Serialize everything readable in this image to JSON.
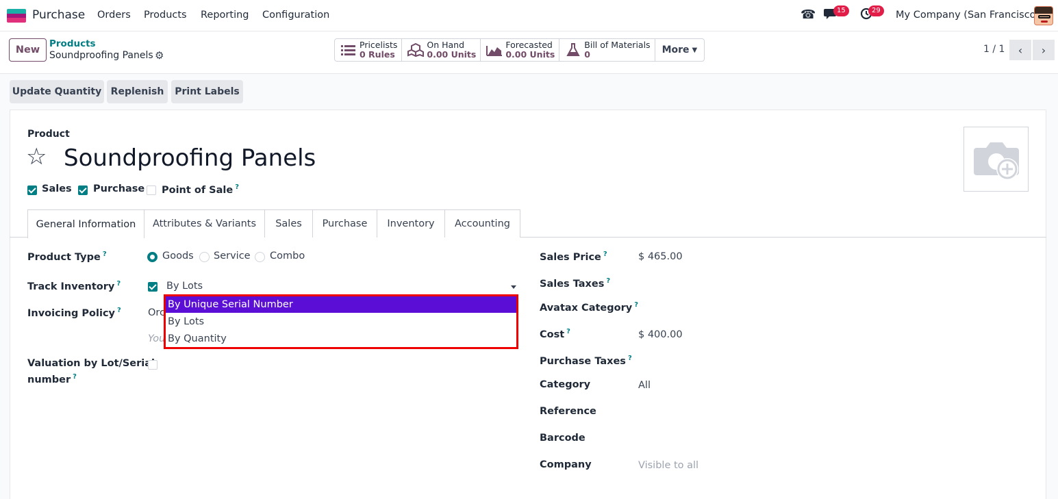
{
  "nav": {
    "app_name": "Purchase",
    "menu": [
      "Orders",
      "Products",
      "Reporting",
      "Configuration"
    ],
    "messages_count": "15",
    "activities_count": "29",
    "company": "My Company (San Francisco)"
  },
  "control": {
    "new_label": "New",
    "breadcrumb_parent": "Products",
    "breadcrumb_current": "Soundproofing Panels",
    "smart_buttons": [
      {
        "title": "Pricelists",
        "value": "0 Rules"
      },
      {
        "title": "On Hand",
        "value": "0.00 Units"
      },
      {
        "title": "Forecasted",
        "value": "0.00 Units"
      },
      {
        "title": "Bill of Materials",
        "value": "0"
      }
    ],
    "more_label": "More",
    "pager": "1 / 1"
  },
  "actions": [
    "Update Quantity",
    "Replenish",
    "Print Labels"
  ],
  "product": {
    "label": "Product",
    "name": "Soundproofing Panels",
    "checkboxes": [
      {
        "label": "Sales",
        "checked": true
      },
      {
        "label": "Purchase",
        "checked": true
      },
      {
        "label": "Point of Sale",
        "checked": false
      }
    ]
  },
  "tabs": [
    "General Information",
    "Attributes & Variants",
    "Sales",
    "Purchase",
    "Inventory",
    "Accounting"
  ],
  "left_fields": {
    "product_type_label": "Product Type",
    "product_type_options": [
      "Goods",
      "Service",
      "Combo"
    ],
    "product_type_selected": "Goods",
    "track_inventory_label": "Track Inventory",
    "track_inventory_value": "By Lots",
    "invoicing_policy_label": "Invoicing Policy",
    "invoicing_policy_value": "Orc",
    "invoicing_hint": "You",
    "valuation_label_1": "Valuation by Lot/Serial",
    "valuation_label_2": "number"
  },
  "dropdown_options": [
    "By Unique Serial Number",
    "By Lots",
    "By Quantity"
  ],
  "right_fields": [
    {
      "label": "Sales Price",
      "help": true,
      "value": "$ 465.00"
    },
    {
      "label": "Sales Taxes",
      "help": true,
      "value": ""
    },
    {
      "label": "Avatax Category",
      "help": true,
      "value": ""
    },
    {
      "label": "Cost",
      "help": true,
      "value": "$ 400.00"
    },
    {
      "label": "Purchase Taxes",
      "help": true,
      "value": ""
    },
    {
      "label": "Category",
      "help": false,
      "value": "All"
    },
    {
      "label": "Reference",
      "help": false,
      "value": ""
    },
    {
      "label": "Barcode",
      "help": false,
      "value": ""
    },
    {
      "label": "Company",
      "help": false,
      "value": "Visible to all"
    }
  ],
  "colors": {
    "primary": "#714b67",
    "accent": "#017e84",
    "selection": "#5b0ed6",
    "highlight_border": "#ee0000"
  }
}
